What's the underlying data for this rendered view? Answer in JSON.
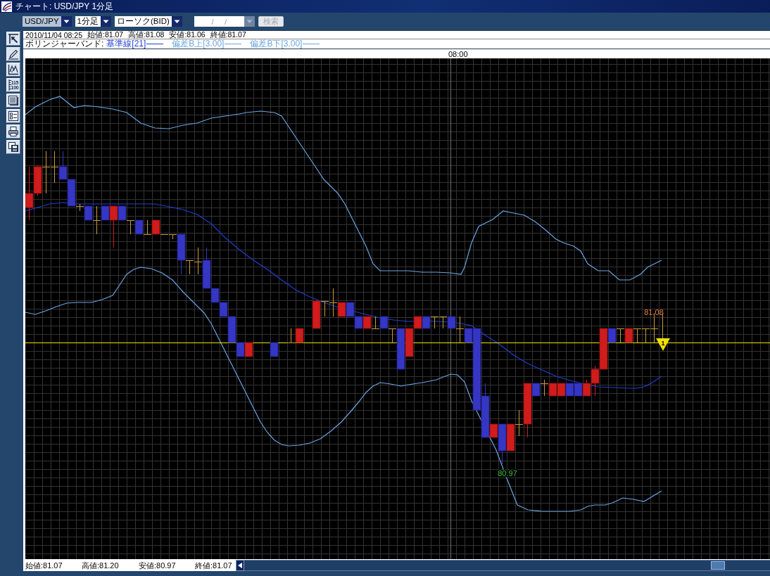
{
  "window": {
    "title": "チャート: USD/JPY 1分足"
  },
  "toolbar": {
    "dropdowns": [
      {
        "value": "USD/JPY",
        "selected": true
      },
      {
        "value": "1分足",
        "selected": false
      },
      {
        "value": "ローソク(BID)",
        "selected": false
      }
    ],
    "date_field": {
      "placeholder": "/ /",
      "disabled": true
    },
    "search_button": {
      "label": "検索",
      "disabled": true
    }
  },
  "side_toolbar": [
    {
      "kind": "pointer"
    },
    {
      "kind": "pencil"
    },
    {
      "kind": "line-chart"
    },
    {
      "kind": "scale",
      "label_lines": [
        "115",
        "100"
      ]
    },
    {
      "kind": "panel"
    },
    {
      "kind": "list"
    },
    {
      "kind": "print"
    },
    {
      "kind": "copy"
    }
  ],
  "info": {
    "quote": [
      "2010/11/04 08:25",
      "始値:81.07",
      "高値:81.08",
      "安値:81.06",
      "終値:81.07"
    ],
    "indicator": {
      "label": "ボリンジャーバンド:",
      "legend": [
        {
          "label": "基準線[21]",
          "color": "#1f3fd2"
        },
        {
          "label": "偏差B上[3.00]",
          "color": "#6aa5e0"
        },
        {
          "label": "偏差B下[3.00]",
          "color": "#6aa5e0"
        }
      ]
    }
  },
  "chart": {
    "time_label": "08:00",
    "high_label": "81.08",
    "low_label": "80.97",
    "position_marker": "1"
  },
  "status_bar": [
    "始値:81.07",
    "高値:81.20",
    "安値:80.97",
    "終値:81.07"
  ]
}
